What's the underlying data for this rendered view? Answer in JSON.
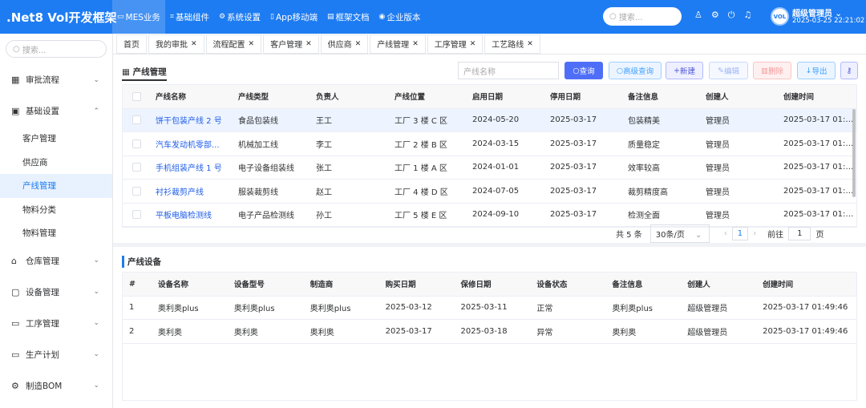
{
  "app_title": ".Net8 Vol开发框架",
  "nav": [
    {
      "icon": "▭",
      "label": "MES业务"
    },
    {
      "icon": "⌗",
      "label": "基础组件"
    },
    {
      "icon": "⚙",
      "label": "系统设置"
    },
    {
      "icon": "▯",
      "label": "App移动端"
    },
    {
      "icon": "▤",
      "label": "框架文档"
    },
    {
      "icon": "◉",
      "label": "企业版本"
    }
  ],
  "header": {
    "search_placeholder": "搜索...",
    "user": "超级管理员",
    "datetime": "2025-03-25 22:21:02",
    "avatar_text": "VOL"
  },
  "sidebar": {
    "search_placeholder": "搜索...",
    "items": [
      {
        "icon": "▦",
        "label": "审批流程"
      },
      {
        "icon": "▣",
        "label": "基础设置"
      },
      {
        "label": "客户管理"
      },
      {
        "label": "供应商"
      },
      {
        "label": "产线管理"
      },
      {
        "label": "物料分类"
      },
      {
        "label": "物料管理"
      },
      {
        "icon": "⌂",
        "label": "仓库管理"
      },
      {
        "icon": "▢",
        "label": "设备管理"
      },
      {
        "icon": "▭",
        "label": "工序管理"
      },
      {
        "icon": "▭",
        "label": "生产计划"
      },
      {
        "icon": "⚙",
        "label": "制造BOM"
      }
    ]
  },
  "tabs": [
    "首页",
    "我的审批",
    "流程配置",
    "客户管理",
    "供应商",
    "产线管理",
    "工序管理",
    "工艺路线"
  ],
  "main": {
    "title": "产线管理",
    "query_placeholder": "产线名称",
    "buttons": {
      "query": "查询",
      "advanced": "高级查询",
      "new": "新建",
      "edit": "编辑",
      "delete": "删除",
      "export": "导出"
    },
    "columns": [
      "产线名称",
      "产线类型",
      "负责人",
      "产线位置",
      "启用日期",
      "停用日期",
      "备注信息",
      "创建人",
      "创建时间"
    ],
    "rows": [
      [
        "饼干包装产线 2 号",
        "食品包装线",
        "王工",
        "工厂 3 楼 C 区",
        "2024-05-20",
        "2025-03-17",
        "包装精美",
        "管理员",
        "2025-03-17 01:1..."
      ],
      [
        "汽车发动机零部...",
        "机械加工线",
        "李工",
        "工厂 2 楼 B 区",
        "2024-03-15",
        "2025-03-17",
        "质量稳定",
        "管理员",
        "2025-03-17 01:1..."
      ],
      [
        "手机组装产线 1 号",
        "电子设备组装线",
        "张工",
        "工厂 1 楼 A 区",
        "2024-01-01",
        "2025-03-17",
        "效率较高",
        "管理员",
        "2025-03-17 01:1..."
      ],
      [
        "衬衫裁剪产线",
        "服装裁剪线",
        "赵工",
        "工厂 4 楼 D 区",
        "2024-07-05",
        "2025-03-17",
        "裁剪精度高",
        "管理员",
        "2025-03-17 01:1..."
      ],
      [
        "平板电脑检测线",
        "电子产品检测线",
        "孙工",
        "工厂 5 楼 E 区",
        "2024-09-10",
        "2025-03-17",
        "检测全面",
        "管理员",
        "2025-03-17 01:1..."
      ]
    ],
    "pager": {
      "total": "共 5 条",
      "page_size": "30条/页",
      "page": "1",
      "goto": "前往",
      "goto_value": "1",
      "page_unit": "页"
    }
  },
  "equipment": {
    "title": "产线设备",
    "columns": [
      "#",
      "设备名称",
      "设备型号",
      "制造商",
      "购买日期",
      "保修日期",
      "设备状态",
      "备注信息",
      "创建人",
      "创建时间"
    ],
    "rows": [
      [
        "1",
        "奥利奥plus",
        "奥利奥plus",
        "奥利奥plus",
        "2025-03-12",
        "2025-03-11",
        "正常",
        "奥利奥plus",
        "超级管理员",
        "2025-03-17 01:49:46"
      ],
      [
        "2",
        "奥利奥",
        "奥利奥",
        "奥利奥",
        "2025-03-17",
        "2025-03-18",
        "异常",
        "奥利奥",
        "超级管理员",
        "2025-03-17 01:49:46"
      ]
    ]
  },
  "colors": {
    "primary": "#1e7cf2",
    "link": "#1e5de8"
  }
}
